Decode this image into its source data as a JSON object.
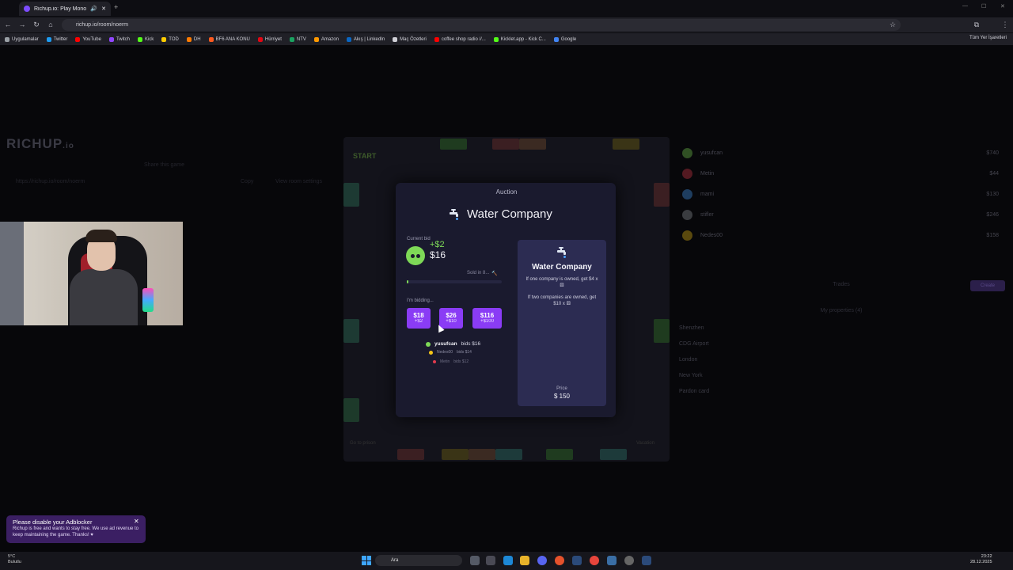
{
  "browser": {
    "tab_title": "Richup.io: Play Monopoly o",
    "url": "richup.io/room/noerm",
    "bookmarks": [
      {
        "label": "Uygulamalar",
        "color": "#9aa0a6"
      },
      {
        "label": "Twitter",
        "color": "#1d9bf0"
      },
      {
        "label": "YouTube",
        "color": "#ff0000"
      },
      {
        "label": "Twitch",
        "color": "#9146ff"
      },
      {
        "label": "Kick",
        "color": "#53fc18"
      },
      {
        "label": "TOD",
        "color": "#ffcc00"
      },
      {
        "label": "DH",
        "color": "#ff7b00"
      },
      {
        "label": "BF6 ANA KONU",
        "color": "#ff5a1f"
      },
      {
        "label": "Hürriyet",
        "color": "#e30613"
      },
      {
        "label": "NTV",
        "color": "#1aa260"
      },
      {
        "label": "Amazon",
        "color": "#ff9900"
      },
      {
        "label": "Akış | LinkedIn",
        "color": "#0a66c2"
      },
      {
        "label": "Maç Özetleri",
        "color": "#cfcfd6"
      },
      {
        "label": "coffee shop radio //...",
        "color": "#ff0000"
      },
      {
        "label": "Kicklet.app - Kick C...",
        "color": "#53fc18"
      },
      {
        "label": "Google",
        "color": "#4285f4"
      }
    ],
    "all_bookmarks": "Tüm Yer İşaretleri"
  },
  "game": {
    "logo_main": "RICHUP",
    "logo_suffix": ".io",
    "share_label": "Share this game",
    "room_link": "https://richup.io/room/noerm",
    "copy_label": "Copy",
    "view_settings_label": "View room settings",
    "start_label": "START",
    "jail_label": "Go to prison",
    "vacation_label": "Vacation",
    "players": [
      {
        "name": "yusufcan",
        "money": "$740",
        "color": "#7ed957"
      },
      {
        "name": "Metin",
        "money": "$44",
        "color": "#e23b4e"
      },
      {
        "name": "mami",
        "money": "$130",
        "color": "#4aa3ff"
      },
      {
        "name": "stifler",
        "money": "$246",
        "color": "#9aa0a6"
      },
      {
        "name": "Nedes00",
        "money": "$158",
        "color": "#f5c518"
      }
    ],
    "trades_label": "Trades",
    "create_label": "Create",
    "my_properties_label": "My properties (4)",
    "my_properties": [
      "Shenzhen",
      "CDG Airport",
      "London",
      "New York",
      "Pardon card"
    ]
  },
  "auction": {
    "heading": "Auction",
    "property_name": "Water Company",
    "current_bid_label": "Current bid",
    "current_bid_increment": "+$2",
    "current_bid_amount": "$16",
    "sold_in": "Sold in 8...",
    "timer_fraction": 0.02,
    "bidding_label": "I'm bidding...",
    "bid_buttons": [
      {
        "amount": "$18",
        "increment": "+$2"
      },
      {
        "amount": "$26",
        "increment": "+$10"
      },
      {
        "amount": "$116",
        "increment": "+$100"
      }
    ],
    "history": [
      {
        "name": "yusufcan",
        "bid": "bids $16",
        "color": "#7ed957"
      },
      {
        "name": "Nedes00",
        "bid": "bids $14",
        "color": "#f5c518"
      },
      {
        "name": "Metin",
        "bid": "bids $12",
        "color": "#e23b4e"
      }
    ],
    "card": {
      "title": "Water Company",
      "rule_one": "If one company is owned, get $4 x",
      "rule_two": "If two companies are owned, get $10 x",
      "price_label": "Price",
      "price": "$ 150"
    }
  },
  "toast": {
    "title": "Please disable your Adblocker",
    "body": "Richup is free and wants to stay free. We use ad revenue to keep maintaining the game. Thanks! ♥",
    "close": "✕"
  },
  "taskbar": {
    "weather_temp": "5°C",
    "weather_desc": "Bulutlu",
    "search_placeholder": "Ara",
    "time": "23:22",
    "date": "28.12.2025"
  }
}
